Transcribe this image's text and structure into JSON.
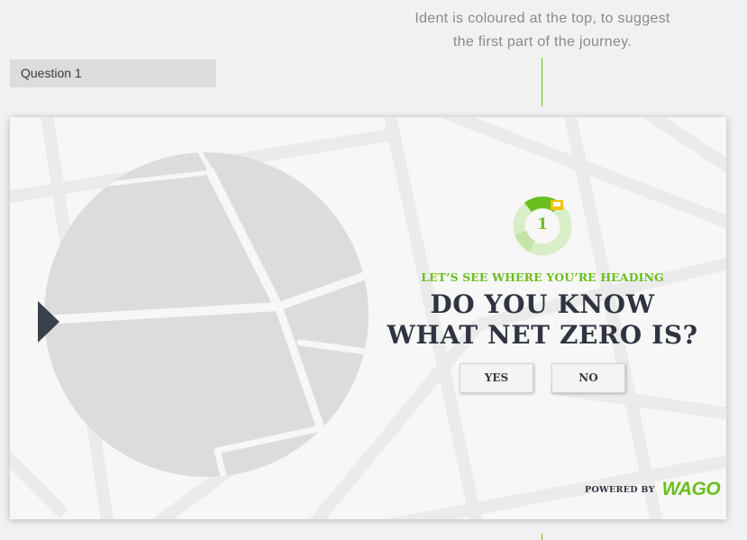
{
  "annotation": {
    "line1": "Ident is coloured at the top, to suggest",
    "line2": "the first part of the journey."
  },
  "question": {
    "label": "Question 1"
  },
  "ident": {
    "number": "1"
  },
  "content": {
    "kicker": "LET’S SEE WHERE YOU’RE HEADING",
    "headline_line1": "DO YOU KNOW",
    "headline_line2": "WHAT NET ZERO IS?"
  },
  "answers": {
    "yes_label": "YES",
    "no_label": "NO"
  },
  "footer": {
    "powered_by": "POWERED BY",
    "brand": "WAGO"
  },
  "colors": {
    "accent": "#6abf1e",
    "dark": "#2f3440",
    "badge": "#f2c200"
  }
}
